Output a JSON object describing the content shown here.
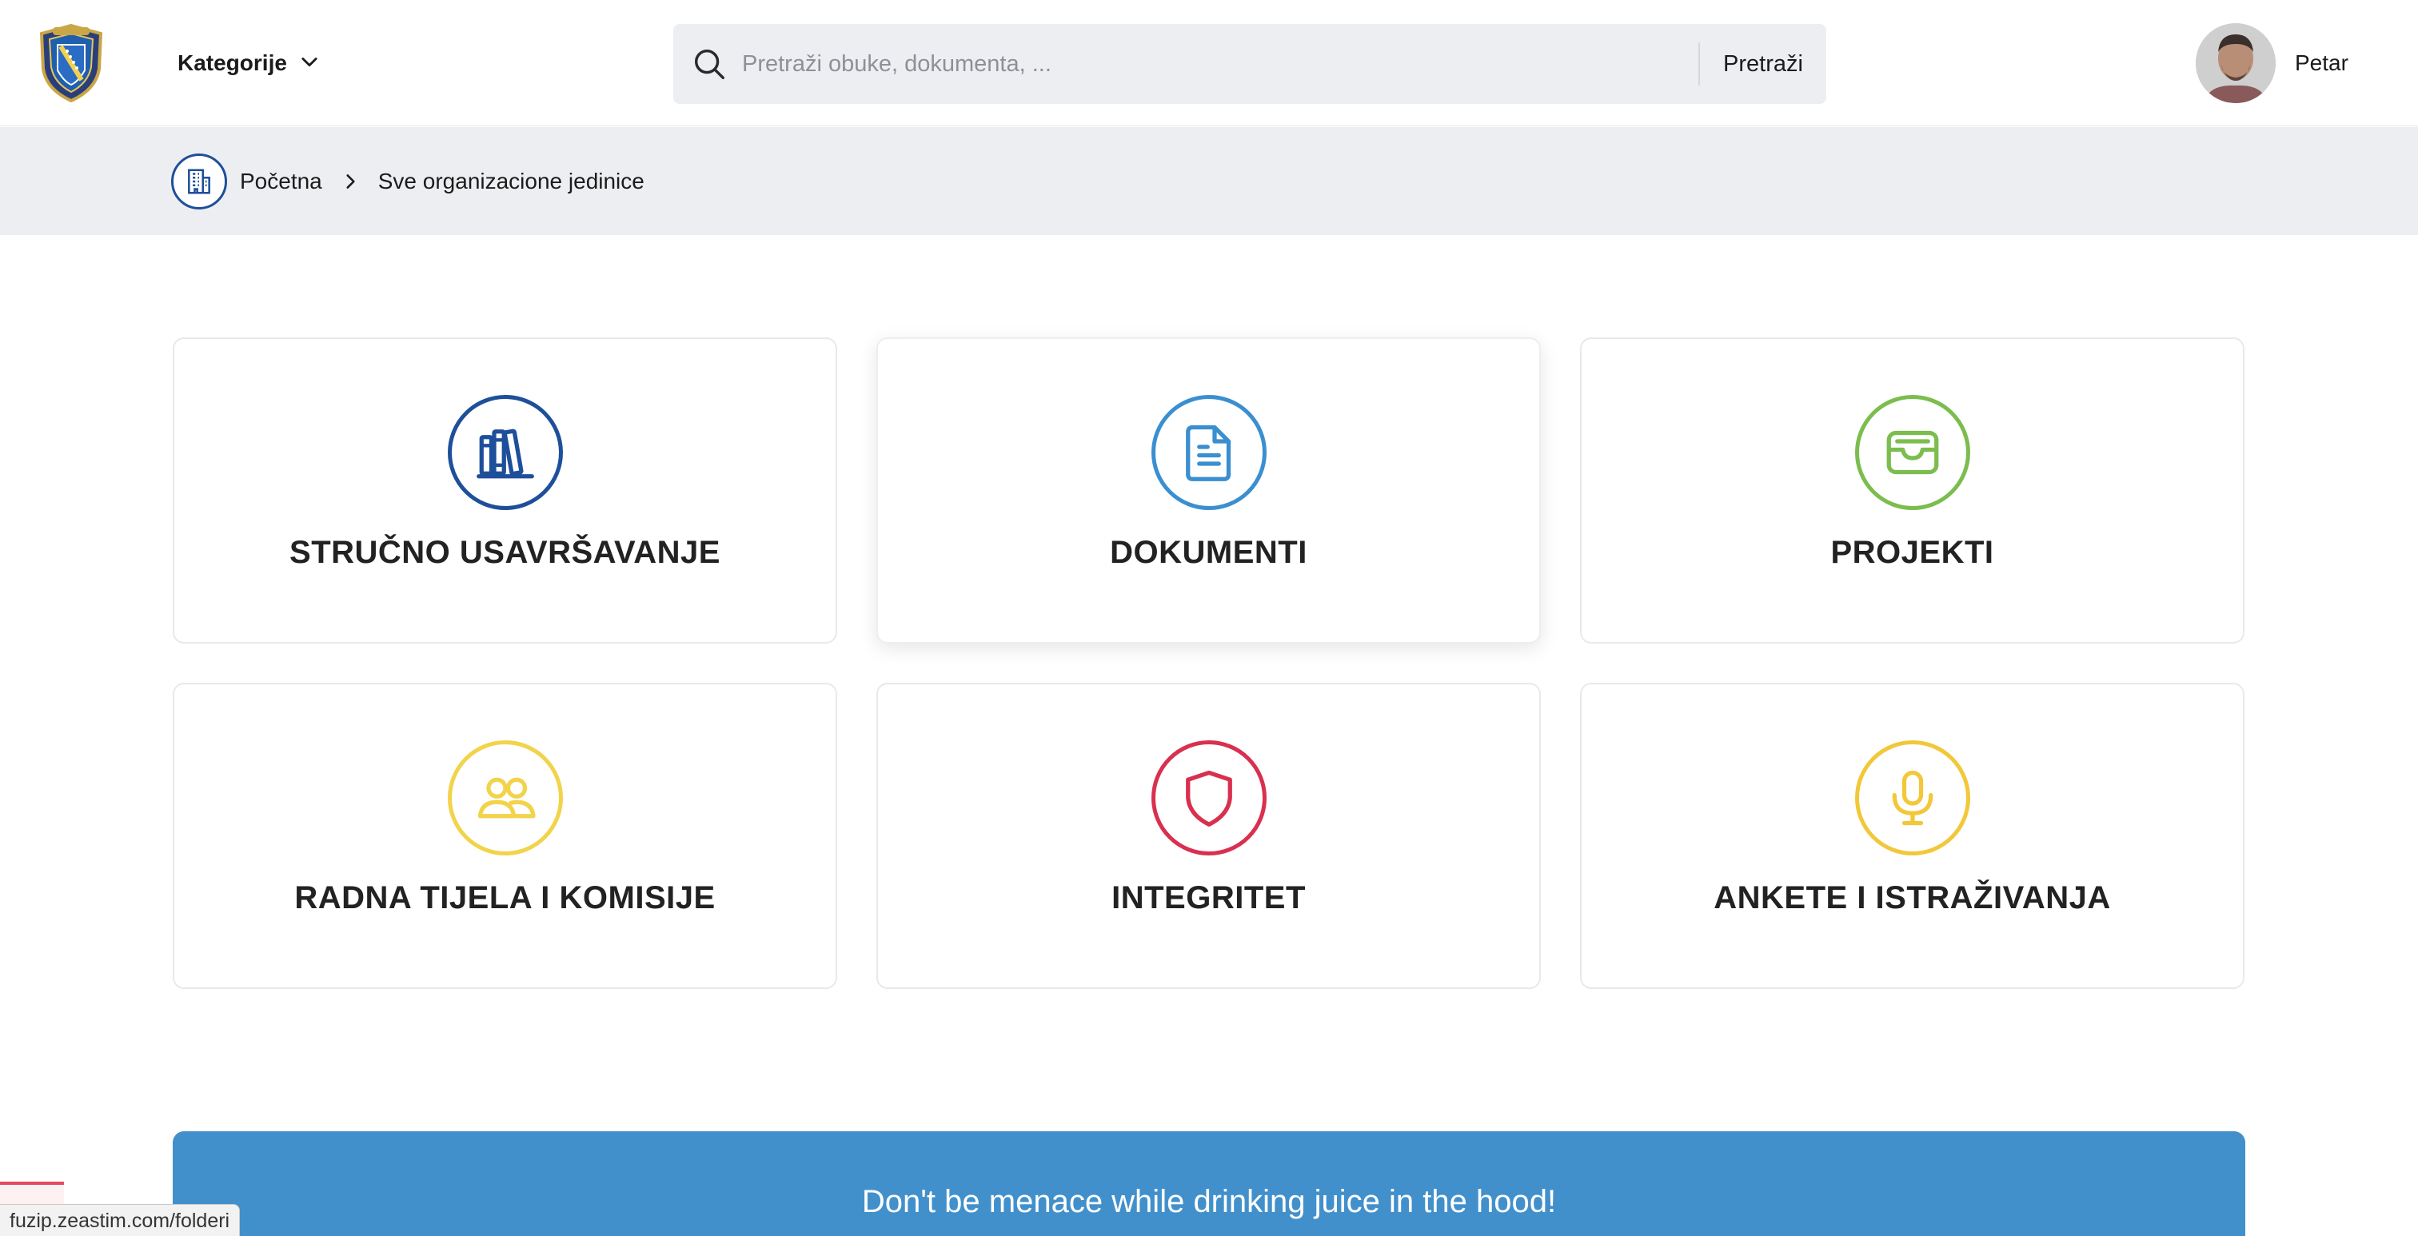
{
  "header": {
    "categories_label": "Kategorije",
    "search_placeholder": "Pretraži obuke, dokumenta, ...",
    "search_button": "Pretraži",
    "user_name": "Petar"
  },
  "breadcrumb": {
    "home": "Početna",
    "current": "Sve organizacione jedinice"
  },
  "cards": [
    {
      "label": "STRUČNO USAVRŠAVANJE",
      "icon": "books-icon",
      "color": "#1e4f9a"
    },
    {
      "label": "DOKUMENTI",
      "icon": "document-icon",
      "color": "#3a8fd0"
    },
    {
      "label": "PROJEKTI",
      "icon": "inbox-icon",
      "color": "#7bbd4e"
    },
    {
      "label": "RADNA TIJELA I KOMISIJE",
      "icon": "users-icon",
      "color": "#f2d34a"
    },
    {
      "label": "INTEGRITET",
      "icon": "shield-icon",
      "color": "#d9304f"
    },
    {
      "label": "ANKETE I ISTRAŽIVANJA",
      "icon": "microphone-icon",
      "color": "#f2c83a"
    }
  ],
  "banner": {
    "text": "Don't be menace while drinking juice in the hood!",
    "color": "#4190cc"
  },
  "status_bar": {
    "url": "fuzip.zeastim.com/folderi"
  }
}
